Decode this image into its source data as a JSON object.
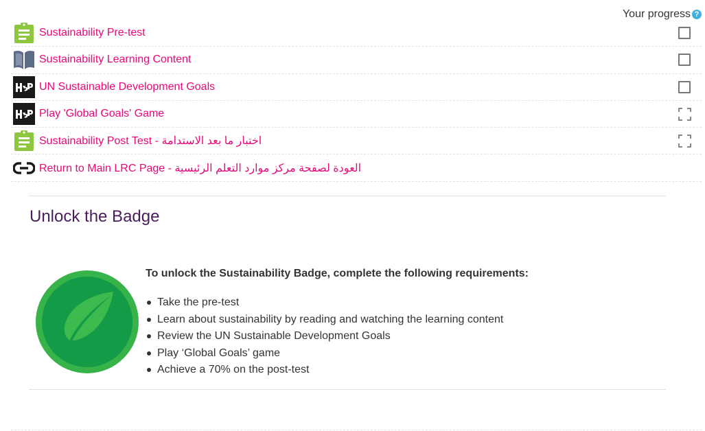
{
  "progress": {
    "label": "Your progress",
    "help_glyph": "?"
  },
  "activities": [
    {
      "icon": "assignment-icon",
      "label": "Sustainability Pre-test",
      "completion": "manual"
    },
    {
      "icon": "book-icon",
      "label": "Sustainability Learning Content",
      "completion": "manual"
    },
    {
      "icon": "h5p-icon",
      "label": "UN Sustainable Development Goals",
      "completion": "manual"
    },
    {
      "icon": "h5p-icon",
      "label": "Play 'Global Goals' Game",
      "completion": "auto"
    },
    {
      "icon": "assignment-icon",
      "label": "Sustainability Post Test - اختبار ما بعد الاستدامة",
      "completion": "auto"
    },
    {
      "icon": "link-icon",
      "label": "Return to Main LRC Page - العودة لصفحة مركز موارد التعلم الرئيسية",
      "completion": "none"
    }
  ],
  "badge": {
    "title": "Unlock the Badge",
    "heading": "To unlock the Sustainability Badge, complete the following requirements:",
    "requirements": [
      "Take the pre-test",
      "Learn about sustainability by reading and watching the learning content",
      "Review the UN Sustainable Development Goals",
      "Play ‘Global Goals’ game",
      "Achieve a 70% on the post-test"
    ],
    "icon": "leaf-badge-icon"
  },
  "colors": {
    "link": "#e8087a",
    "title": "#4a1d5a",
    "assignment_icon": "#8dc63f",
    "badge_outer": "#37b34a",
    "badge_inner": "#139b48"
  }
}
